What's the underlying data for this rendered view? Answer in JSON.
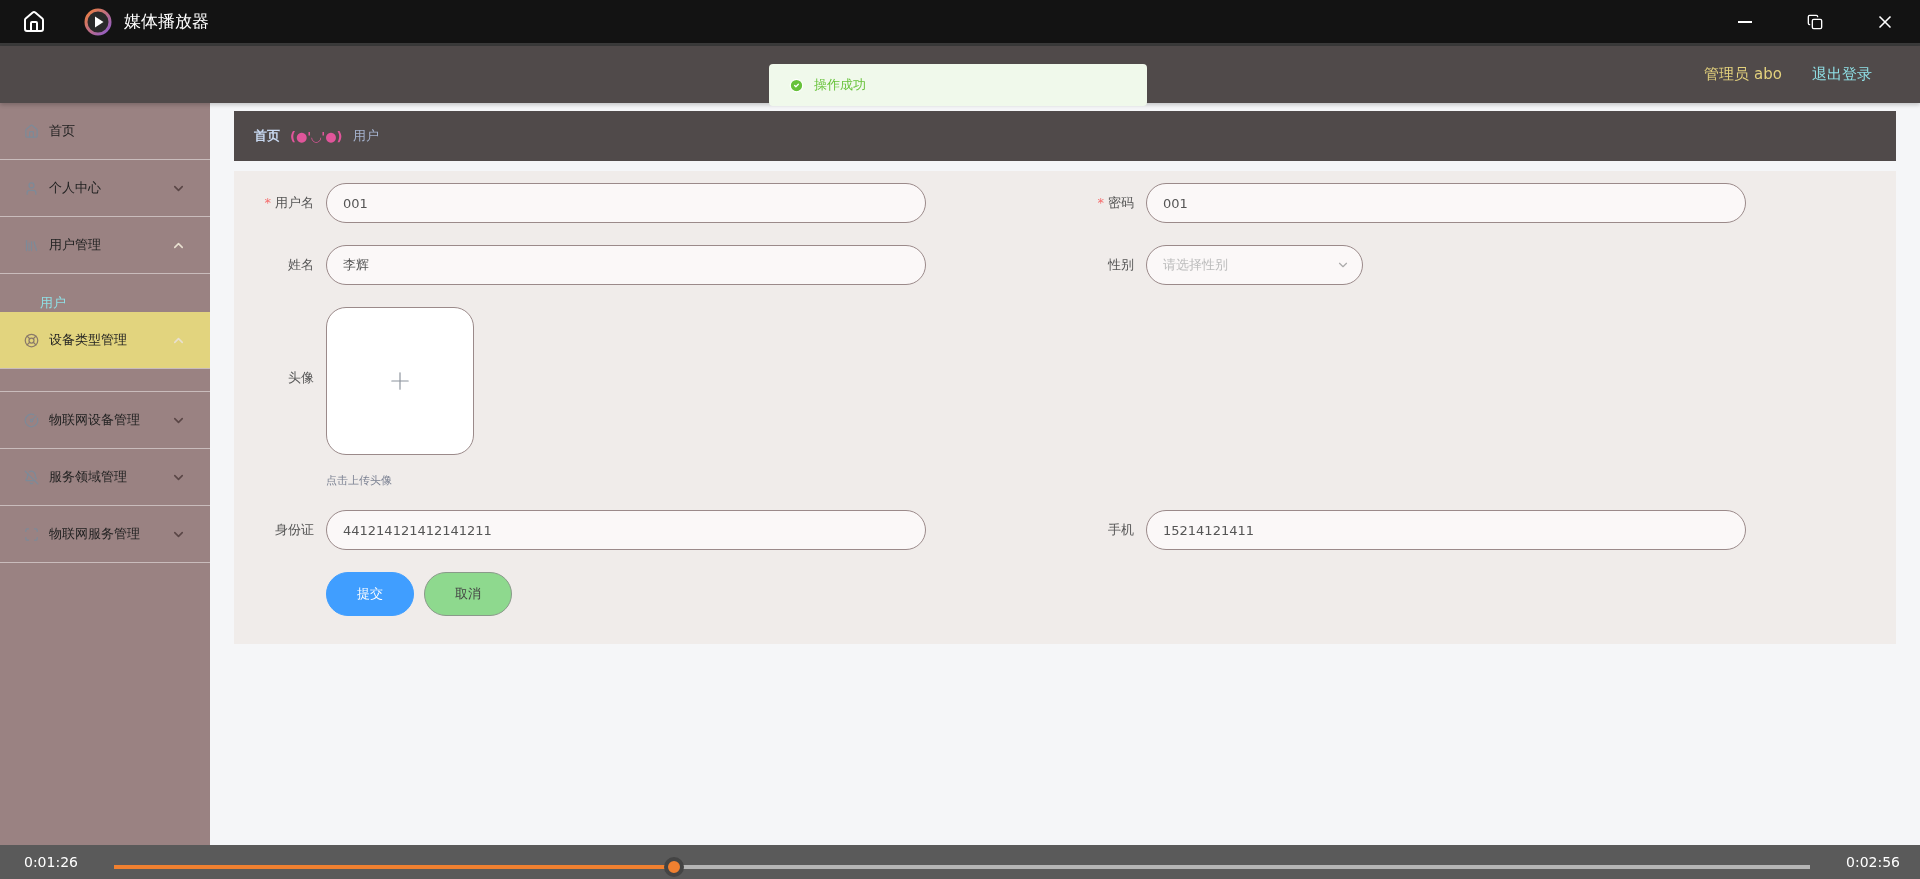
{
  "titlebar": {
    "title": "媒体播放器"
  },
  "header": {
    "user": "管理员 abo",
    "logout": "退出登录"
  },
  "toast": {
    "message": "操作成功"
  },
  "sidebar": {
    "items": [
      {
        "label": "首页",
        "kind": "link",
        "selected": false
      },
      {
        "label": "个人中心",
        "kind": "submenu",
        "selected": false,
        "expanded": false
      },
      {
        "label": "用户管理",
        "kind": "submenu",
        "selected": false,
        "expanded": true,
        "children": [
          {
            "label": "用户",
            "selected": true
          }
        ]
      },
      {
        "label": "设备类型管理",
        "kind": "submenu",
        "selected": true,
        "expanded": true
      },
      {
        "label": "物联网设备管理",
        "kind": "submenu",
        "selected": false,
        "expanded": false
      },
      {
        "label": "服务领域管理",
        "kind": "submenu",
        "selected": false,
        "expanded": false
      },
      {
        "label": "物联网服务管理",
        "kind": "submenu",
        "selected": false,
        "expanded": false
      }
    ]
  },
  "breadcrumb": {
    "home": "首页",
    "separator": "(●'◡'●)",
    "current": "用户"
  },
  "form": {
    "rows": [
      [
        {
          "kind": "text",
          "required_mark": "*",
          "label": "用户名",
          "value": "001"
        },
        {
          "kind": "text",
          "required_mark": "*",
          "label": "密码",
          "value": "001"
        }
      ],
      [
        {
          "kind": "text",
          "label": "姓名",
          "value": "李辉"
        },
        {
          "kind": "select",
          "label": "性别",
          "placeholder": "请选择性别"
        }
      ],
      [
        {
          "kind": "upload",
          "label": "头像",
          "hint": "点击上传头像"
        }
      ],
      [
        {
          "kind": "text",
          "label": "身份证",
          "value": "441214121412141211"
        },
        {
          "kind": "text",
          "label": "手机",
          "value": "15214121411"
        }
      ]
    ],
    "buttons": [
      {
        "label": "提交",
        "kind": "primary"
      },
      {
        "label": "取消",
        "kind": "secondary"
      }
    ]
  },
  "player": {
    "elapsed": "0:01:26",
    "total": "0:02:56",
    "level": 0.33
  }
}
